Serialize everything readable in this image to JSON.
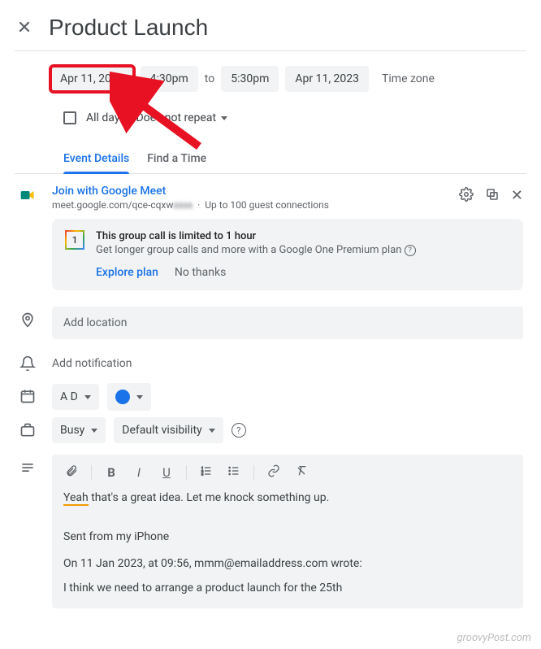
{
  "header": {
    "title": "Product Launch"
  },
  "datetime": {
    "start_date": "Apr 11, 2023",
    "start_time": "4:30pm",
    "to_label": "to",
    "end_time": "5:30pm",
    "end_date": "Apr 11, 2023",
    "timezone_label": "Time zone",
    "all_day_label": "All day",
    "repeat_label": "Does not repeat"
  },
  "tabs": {
    "details": "Event Details",
    "find_time": "Find a Time"
  },
  "meet": {
    "join_label": "Join with Google Meet",
    "url": "meet.google.com/qce-cqxw",
    "guests": "Up to 100 guest connections"
  },
  "gone": {
    "badge": "1",
    "title": "This group call is limited to 1 hour",
    "subtitle": "Get longer group calls and more with a Google One Premium plan",
    "explore": "Explore plan",
    "no_thanks": "No thanks"
  },
  "location": {
    "placeholder": "Add location"
  },
  "notification": {
    "label": "Add notification"
  },
  "calendar": {
    "owner": "A D"
  },
  "availability": {
    "busy": "Busy",
    "visibility": "Default visibility"
  },
  "description": {
    "line1_hl": "Yeah",
    "line1_rest": " that's a great idea. Let me knock something up.",
    "line2": "Sent from my iPhone",
    "line3": "On 11 Jan 2023, at 09:56, mmm@emailaddress.com wrote:",
    "line4": "I think we need to arrange a product launch for the 25th"
  },
  "watermark": "groovyPost.com"
}
